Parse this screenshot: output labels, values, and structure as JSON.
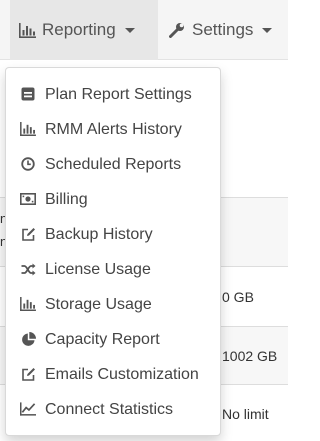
{
  "navbar": {
    "reporting_label": "Reporting",
    "settings_label": "Settings"
  },
  "dropdown": {
    "items": [
      {
        "label": "Plan Report Settings",
        "icon": "list-alt-icon"
      },
      {
        "label": "RMM Alerts History",
        "icon": "bar-chart-icon"
      },
      {
        "label": "Scheduled Reports",
        "icon": "clock-icon"
      },
      {
        "label": "Billing",
        "icon": "money-icon"
      },
      {
        "label": "Backup History",
        "icon": "edit-icon"
      },
      {
        "label": "License Usage",
        "icon": "random-icon"
      },
      {
        "label": "Storage Usage",
        "icon": "bar-chart-icon"
      },
      {
        "label": "Capacity Report",
        "icon": "pie-chart-icon"
      },
      {
        "label": "Emails Customization",
        "icon": "edit-icon"
      },
      {
        "label": "Connect Statistics",
        "icon": "line-chart-icon"
      }
    ]
  },
  "background": {
    "cell_1": "0 GB",
    "cell_2": "1002 GB",
    "cell_3": "No limit",
    "left_fragment_1": "n",
    "left_fragment_2": "n"
  },
  "colors": {
    "navbar_bg": "#f5f5f5",
    "active_nav_bg": "#e7e7e7",
    "text": "#444444"
  }
}
